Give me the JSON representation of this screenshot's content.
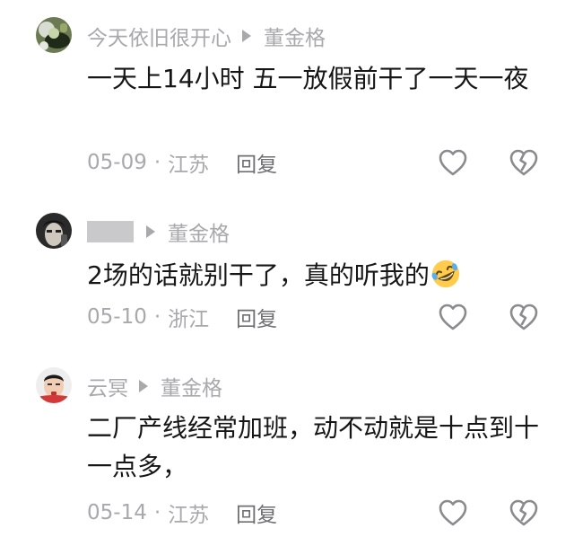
{
  "comments": [
    {
      "username": "今天依旧很开心",
      "reply_to": "董金格",
      "text": "一天上14小时 五一放假前干了一天一夜",
      "date": "05-09",
      "location": "江苏",
      "reply_label": "回复"
    },
    {
      "username": "",
      "reply_to": "董金格",
      "text": "2场的话就别干了，真的听我的",
      "date": "05-10",
      "location": "浙江",
      "reply_label": "回复"
    },
    {
      "username": "云冥",
      "reply_to": "董金格",
      "text": "二厂产线经常加班，动不动就是十点到十一点多，",
      "date": "05-14",
      "location": "江苏",
      "reply_label": "回复"
    }
  ],
  "icons": {
    "reply_to": "triangle-right-icon",
    "like": "heart-outline-icon",
    "dislike": "broken-heart-outline-icon",
    "emoji": "rolling-on-floor-laughing-emoji"
  },
  "colors": {
    "meta_text": "#a8a8ad",
    "body_text": "#161616",
    "reply_button": "#6f6f74",
    "icon_stroke": "#8a8a8f"
  }
}
